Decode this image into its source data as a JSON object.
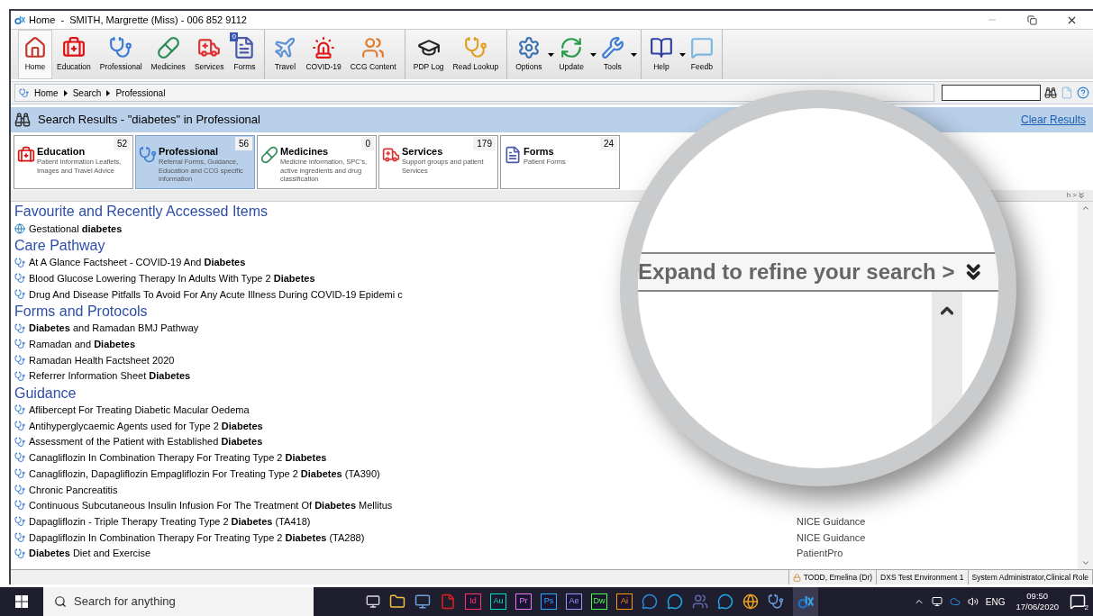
{
  "window": {
    "title": "Home  -  SMITH, Margrette (Miss) - 006 852 9112"
  },
  "toolbar": {
    "groups": [
      [
        {
          "label": "Home",
          "selected": true
        },
        {
          "label": "Education",
          "selected": false
        },
        {
          "label": "Professional",
          "selected": false
        },
        {
          "label": "Medicines",
          "selected": false
        },
        {
          "label": "Services",
          "selected": false
        },
        {
          "label": "Forms",
          "selected": false,
          "badge": "0"
        }
      ],
      [
        {
          "label": "Travel",
          "selected": false
        },
        {
          "label": "COVID-19",
          "selected": false
        },
        {
          "label": "CCG Content",
          "selected": false
        }
      ],
      [
        {
          "label": "PDP Log",
          "selected": false
        },
        {
          "label": "Read Lookup",
          "selected": false
        }
      ],
      [
        {
          "label": "Options",
          "selected": false,
          "dropdown": true
        },
        {
          "label": "Update",
          "selected": false,
          "dropdown": true
        },
        {
          "label": "Tools",
          "selected": false,
          "dropdown": true
        }
      ],
      [
        {
          "label": "Help",
          "selected": false,
          "dropdown": true
        },
        {
          "label": "Feedb",
          "selected": false
        }
      ]
    ]
  },
  "breadcrumb": [
    "Home",
    "Search",
    "Professional"
  ],
  "results_header": {
    "title": "Search Results - \"diabetes\" in Professional",
    "clear_link": "Clear Results"
  },
  "categories": [
    {
      "title": "Education",
      "count": "52",
      "description": "Patient Information Leaflets, Images and Travel Advice",
      "selected": false
    },
    {
      "title": "Professional",
      "count": "56",
      "description": "Referral Forms, Guidance, Education and CCG specific information",
      "selected": true
    },
    {
      "title": "Medicines",
      "count": "0",
      "description": "Medicine information, SPC's, active ingredients and drug classification",
      "selected": false
    },
    {
      "title": "Services",
      "count": "179",
      "description": "Support groups and patient Services",
      "selected": false
    },
    {
      "title": "Forms",
      "count": "24",
      "description": "Patient Forms",
      "selected": false
    }
  ],
  "refine_fragment": "h >",
  "sections": [
    {
      "heading": "Favourite and Recently Accessed Items",
      "items": [
        {
          "kind": "favourite",
          "text": "Gestational **diabetes**"
        }
      ]
    },
    {
      "heading": "Care Pathway",
      "items": [
        {
          "kind": "professional",
          "text": "At A Glance Factsheet - COVID-19 And  **Diabetes**"
        },
        {
          "kind": "professional",
          "text": "Blood Glucose Lowering Therapy In Adults With Type 2  **Diabetes**"
        },
        {
          "kind": "professional",
          "text": "Drug And Disease Pitfalls To Avoid For Any Acute Illness During COVID-19 Epidemi c"
        }
      ]
    },
    {
      "heading": "Forms and Protocols",
      "items": [
        {
          "kind": "professional",
          "text": "**Diabetes** and Ramadan BMJ Pathway"
        },
        {
          "kind": "professional",
          "text": "Ramadan and **Diabetes**"
        },
        {
          "kind": "professional",
          "text": "Ramadan Health Factsheet 2020"
        },
        {
          "kind": "professional",
          "text": "Referrer Information Sheet **Diabetes**"
        }
      ]
    },
    {
      "heading": "Guidance",
      "items": [
        {
          "kind": "professional",
          "text": "Aflibercept For Treating Diabetic Macular Oedema"
        },
        {
          "kind": "professional",
          "text": "Antihyperglycaemic Agents used for Type 2  **Diabetes**"
        },
        {
          "kind": "professional",
          "text": "Assessment of the Patient with Established **Diabetes**"
        },
        {
          "kind": "professional",
          "text": "Canagliflozin In Combination Therapy For Treating Type 2 **Diabetes**"
        },
        {
          "kind": "professional",
          "text": "Canagliflozin, Dapagliflozin  Empagliflozin For Treating Type 2 **Diabetes** (TA390)"
        },
        {
          "kind": "professional",
          "text": "Chronic Pancreatitis"
        },
        {
          "kind": "professional",
          "text": "Continuous Subcutaneous Insulin Infusion For The Treatment Of **Diabetes** Mellitus"
        },
        {
          "kind": "professional",
          "text": "Dapagliflozin - Triple Therapy Treating Type 2 **Diabetes** (TA418)",
          "source": "NICE Guidance"
        },
        {
          "kind": "professional",
          "text": "Dapagliflozin In Combination Therapy For Treating Type 2 **Diabetes** (TA288)",
          "source": "NICE Guidance"
        },
        {
          "kind": "professional",
          "text": "**Diabetes** Diet and Exercise",
          "source": "PatientPro"
        }
      ]
    }
  ],
  "magnifier": {
    "text": "Expand to refine your search >"
  },
  "status_bar": [
    "TODD, Emelina (Dr)",
    "DXS Test Environment 1",
    "System Administrator,Clinical Role"
  ],
  "taskbar": {
    "search_placeholder": "Search for anything",
    "apps": [
      "Id",
      "Au",
      "Pr",
      "Ps",
      "Ae",
      "Dw",
      "Ai"
    ],
    "language": "ENG",
    "time": "09:50",
    "date": "17/06/2020",
    "notifications": "2"
  }
}
